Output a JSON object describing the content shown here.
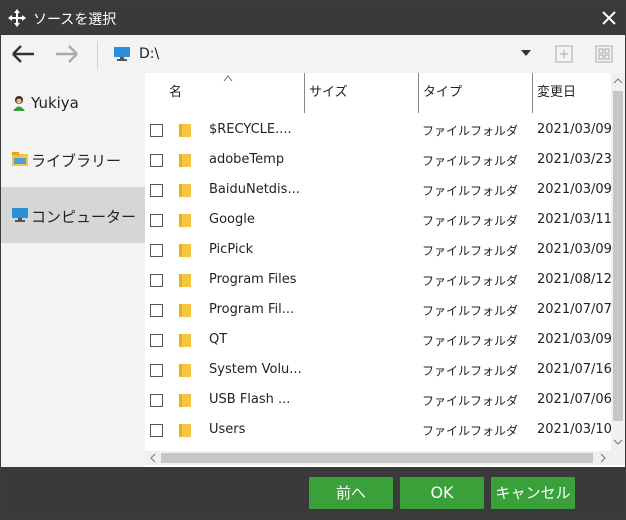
{
  "window": {
    "title": "ソースを選択"
  },
  "toolbar": {
    "path": "D:\\"
  },
  "sidebar": {
    "items": [
      {
        "label": "Yukiya",
        "icon": "user-icon"
      },
      {
        "label": "ライブラリー",
        "icon": "library-icon"
      },
      {
        "label": "コンピューター",
        "icon": "computer-icon",
        "selected": true
      }
    ]
  },
  "columns": {
    "name": "名",
    "size": "サイズ",
    "type": "タイプ",
    "modified": "変更日"
  },
  "files": [
    {
      "name": "$RECYCLE....",
      "type": "ファイルフォルダ",
      "date": "2021/03/09"
    },
    {
      "name": "adobeTemp",
      "type": "ファイルフォルダ",
      "date": "2021/03/23"
    },
    {
      "name": "BaiduNetdis...",
      "type": "ファイルフォルダ",
      "date": "2021/03/09"
    },
    {
      "name": "Google",
      "type": "ファイルフォルダ",
      "date": "2021/03/11"
    },
    {
      "name": "PicPick",
      "type": "ファイルフォルダ",
      "date": "2021/03/09"
    },
    {
      "name": "Program Files",
      "type": "ファイルフォルダ",
      "date": "2021/08/12"
    },
    {
      "name": "Program Fil...",
      "type": "ファイルフォルダ",
      "date": "2021/07/07"
    },
    {
      "name": "QT",
      "type": "ファイルフォルダ",
      "date": "2021/03/09"
    },
    {
      "name": "System Volu...",
      "type": "ファイルフォルダ",
      "date": "2021/07/16"
    },
    {
      "name": "USB Flash ...",
      "type": "ファイルフォルダ",
      "date": "2021/07/06"
    },
    {
      "name": "Users",
      "type": "ファイルフォルダ",
      "date": "2021/03/10"
    }
  ],
  "footer": {
    "prev": "前へ",
    "ok": "OK",
    "cancel": "キャンセル"
  },
  "colors": {
    "titlebar": "#3a3a3a",
    "button": "#3aa03a",
    "folder": "#f5c542",
    "selected": "#d6d6d6"
  }
}
